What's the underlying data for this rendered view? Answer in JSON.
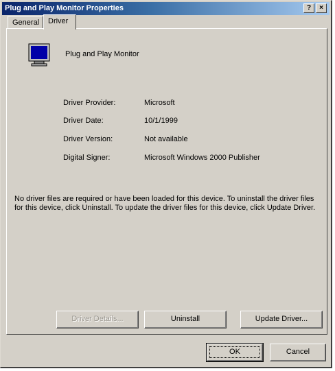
{
  "window": {
    "title": "Plug and Play Monitor Properties",
    "help_glyph": "?",
    "close_glyph": "×"
  },
  "tabs": [
    {
      "label": "General",
      "active": false
    },
    {
      "label": "Driver",
      "active": true
    }
  ],
  "device": {
    "name": "Plug and Play Monitor",
    "icon": "monitor-icon"
  },
  "details": [
    {
      "label": "Driver Provider:",
      "value": "Microsoft"
    },
    {
      "label": "Driver Date:",
      "value": "10/1/1999"
    },
    {
      "label": "Driver Version:",
      "value": "Not available"
    },
    {
      "label": "Digital Signer:",
      "value": "Microsoft Windows 2000 Publisher"
    }
  ],
  "note": "No driver files are required or have been loaded for this device. To uninstall the driver files for this device, click Uninstall. To update the driver files for this device, click Update Driver.",
  "buttons": {
    "driver_details": "Driver Details...",
    "uninstall": "Uninstall",
    "update_driver": "Update Driver...",
    "ok": "OK",
    "cancel": "Cancel"
  },
  "colors": {
    "face": "#d4d0c8",
    "title_active": "#0a246a",
    "title_gradient_end": "#a6caf0"
  }
}
